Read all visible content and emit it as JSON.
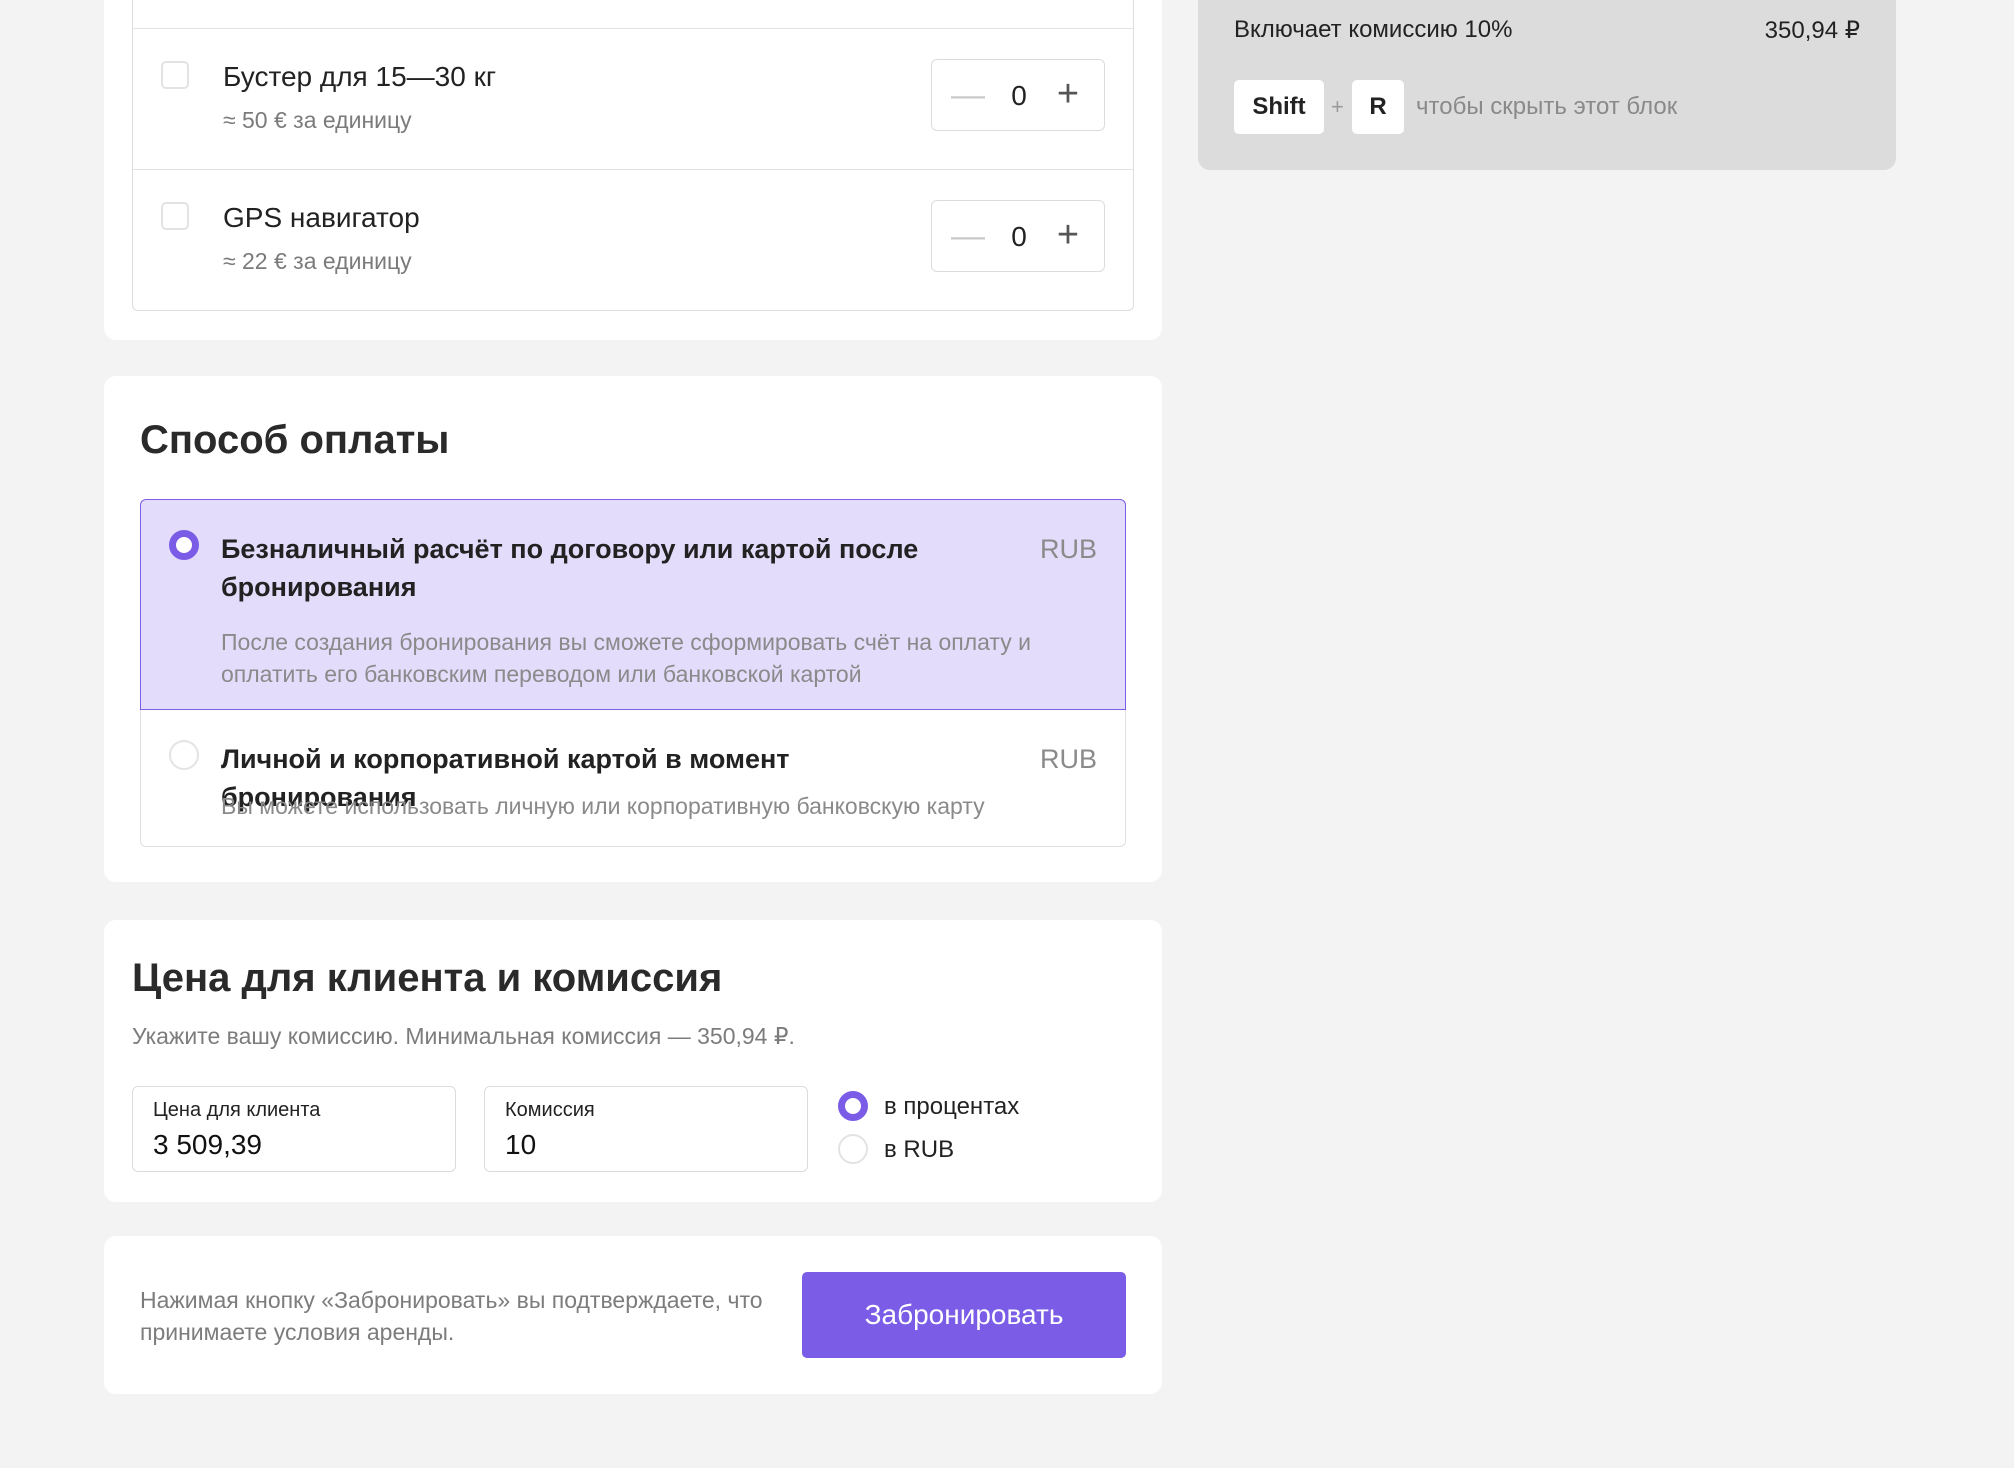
{
  "extras": {
    "items": [
      {
        "name": "Бустер для 15—30 кг",
        "price": "≈ 50 € за единицу",
        "quantity": "0",
        "minus": "—",
        "plus": "+"
      },
      {
        "name": "GPS навигатор",
        "price": "≈ 22 € за единицу",
        "quantity": "0",
        "minus": "—",
        "plus": "+"
      }
    ]
  },
  "payment": {
    "title": "Способ оплаты",
    "options": [
      {
        "title": "Безналичный расчёт по договору или картой после бронирования",
        "currency": "RUB",
        "description": "После создания бронирования вы сможете сформировать счёт на оплату и оплатить его банковским переводом или банковской картой",
        "selected": true
      },
      {
        "title": "Личной и корпоративной картой в момент бронирования",
        "currency": "RUB",
        "description": "Вы можете использовать личную или корпоративную банковскую карту",
        "selected": false
      }
    ]
  },
  "pricing": {
    "title": "Цена для клиента и комиссия",
    "hint": "Укажите вашу комиссию. Минимальная комиссия — 350,94 ₽.",
    "client_price": {
      "label": "Цена для клиента",
      "value": "3 509,39"
    },
    "commission": {
      "label": "Комиссия",
      "value": "10"
    },
    "units": [
      {
        "label": "в процентах",
        "selected": true
      },
      {
        "label": "в RUB",
        "selected": false
      }
    ]
  },
  "booking": {
    "terms": "Нажимая кнопку «Забронировать» вы подтверждаете, что принимаете условия аренды.",
    "button_label": "Забронировать"
  },
  "summary": {
    "fee_label": "Включает комиссию 10%",
    "fee_value": "350,94 ₽",
    "shortcut_key1": "Shift",
    "shortcut_plus": "+",
    "shortcut_key2": "R",
    "shortcut_hint": "чтобы скрыть этот блок"
  },
  "colors": {
    "accent": "#7b5ce6",
    "selected_bg": "#e3dcfb",
    "page_bg": "#f3f3f3",
    "summary_bg": "#dcdcdc"
  }
}
